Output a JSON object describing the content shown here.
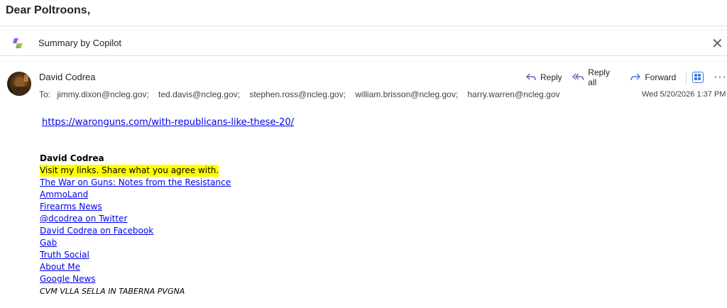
{
  "subject": "Dear Poltroons,",
  "copilot": {
    "label": "Summary by Copilot"
  },
  "message": {
    "sender": "David Codrea",
    "to_label": "To:",
    "recipients": [
      "jimmy.dixon@ncleg.gov;",
      "ted.davis@ncleg.gov;",
      "stephen.ross@ncleg.gov;",
      "william.brisson@ncleg.gov;",
      "harry.warren@ncleg.gov"
    ],
    "date": "Wed 5/20/2026 1:37 PM",
    "actions": {
      "reply": "Reply",
      "reply_all": "Reply all",
      "forward": "Forward"
    },
    "body_link": "https://waronguns.com/with-republicans-like-these-20/"
  },
  "signature": {
    "name": "David Codrea",
    "tagline": "Visit my links. Share what you agree with.",
    "links": [
      "The War on Guns: Notes from the Resistance",
      "AmmoLand",
      "Firearms News",
      "@dcodrea on Twitter",
      "David Codrea on Facebook",
      "Gab",
      "Truth Social",
      "About Me",
      "Google News"
    ],
    "motto": "CVM VLLA SELLA IN TABERNA PVGNA"
  },
  "colors": {
    "link": "#0000ee",
    "highlight": "#ffff00",
    "accent": "#3a7bd5"
  },
  "icons": [
    "copilot-icon",
    "close-icon",
    "reply-icon",
    "reply-all-icon",
    "forward-icon",
    "apps-icon",
    "more-icon"
  ]
}
